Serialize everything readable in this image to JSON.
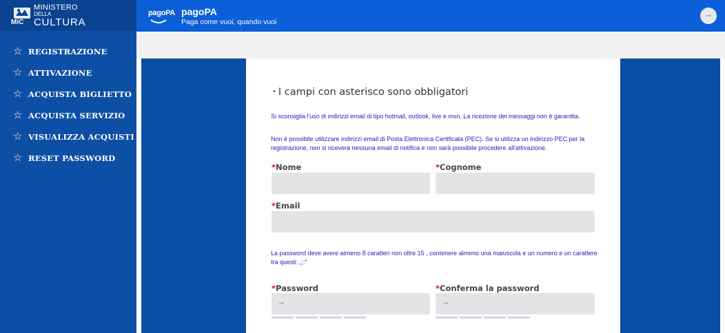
{
  "brand": {
    "logo_line1": "MINISTERO",
    "logo_line2": "DELLA",
    "logo_line3": "CULTURA",
    "logo_mic": "MiC"
  },
  "sidebar": {
    "items": [
      {
        "label": "REGISTRAZIONE",
        "icon": "star-outline-icon"
      },
      {
        "label": "ATTIVAZIONE",
        "icon": "star-outline-icon"
      },
      {
        "label": "ACQUISTA BIGLIETTO",
        "icon": "star-outline-icon"
      },
      {
        "label": "ACQUISTA SERVIZIO",
        "icon": "star-outline-icon"
      },
      {
        "label": "VISUALIZZA ACQUISTI",
        "icon": "star-outline-icon"
      },
      {
        "label": "RESET PASSWORD",
        "icon": "star-outline-icon"
      }
    ]
  },
  "header": {
    "logo_text": "pagoPA",
    "title": "pagoPA",
    "subtitle": "Paga come vuoi, quando vuoi",
    "user_icon": "key-icon"
  },
  "form": {
    "required_note": "I campi con asterisco sono obbligatori",
    "info_email": "Si sconsiglia l'uso di indirizzi email di tipo hotmail, outlook, live e msn. La ricezione dei messaggi non è garantita.",
    "info_pec": "Non è possibile utilizzare indirizzi email di Posta Elettronica Certificata (PEC). Se si utilizza un indirizzo PEC per la registrazione, non si riceverà nessuna email di notifica e non sarà possibile procedere all'attivazione.",
    "info_password": "La password deve avere almeno 8 caratteri non oltre 15 , contenere almeno una maiuscola e un numero e un carattere tra questi .,;:\"",
    "asterisk": "*",
    "fields": {
      "nome": {
        "label": "Nome",
        "value": ""
      },
      "cognome": {
        "label": "Cognome",
        "value": ""
      },
      "email": {
        "label": "Email",
        "value": ""
      },
      "password": {
        "label": "Password",
        "value": ""
      },
      "conferma": {
        "label": "Conferma la password",
        "value": ""
      }
    }
  },
  "colors": {
    "sidebar": "#0e4fa6",
    "topbar": "#0b5fd8",
    "side_panel": "#0a4ea3",
    "info_text": "#2323b8",
    "required": "#d01010"
  }
}
